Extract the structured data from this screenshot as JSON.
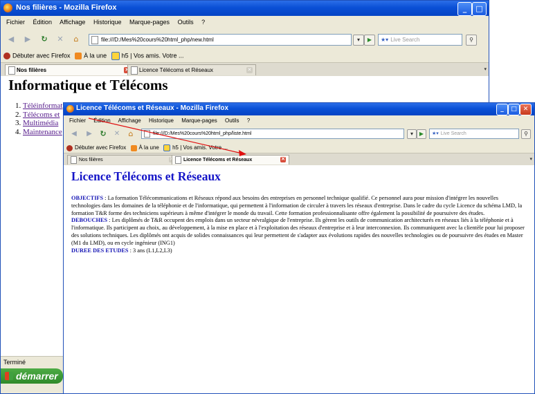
{
  "window1": {
    "title": "Nos filières - Mozilla Firefox",
    "menu": [
      "Fichier",
      "Édition",
      "Affichage",
      "Historique",
      "Marque-pages",
      "Outils",
      "?"
    ],
    "url": "file:///D:/Mes%20cours%20html_php/new.html",
    "search_placeholder": "Live Search",
    "bookmarks": [
      "Débuter avec Firefox",
      "À la une",
      "h5 | Vos amis. Votre ..."
    ],
    "tabs": [
      {
        "label": "Nos filières",
        "active": true
      },
      {
        "label": "Licence Télécoms et Réseaux",
        "active": false
      }
    ],
    "heading": "Informatique et Télécoms",
    "links": [
      "Téléinformat",
      "Télécoms et",
      "Multimédia",
      "Maintenance"
    ],
    "status": "Terminé",
    "start_label": "démarrer"
  },
  "window2": {
    "title": "Licence Télécoms et Réseaux - Mozilla Firefox",
    "menu": [
      "Fichier",
      "Édition",
      "Affichage",
      "Historique",
      "Marque-pages",
      "Outils",
      "?"
    ],
    "url": "file:///D:/Mes%20cours%20html_php/liste.html",
    "search_placeholder": "Live Search",
    "bookmarks": [
      "Débuter avec Firefox",
      "À la une",
      "h5 | Vos amis. Votre ..."
    ],
    "tabs": [
      {
        "label": "Nos filières",
        "active": false
      },
      {
        "label": "Licence Télécoms et Réseaux",
        "active": true
      }
    ],
    "heading": "Licence Télécoms et Réseaux",
    "sections": [
      {
        "label": "OBJECTIFS",
        "text": " : La formation Télécommunications et Réseaux répond aux besoins des entreprises en personnel technique qualifié. Ce personnel aura pour mission d'intégrer les nouvelles technologies dans les domaines de la téléphonie et de l'informatique, qui permettent à l'information de circuler à travers les réseaux d'entreprise. Dans le cadre du cycle Licence du schéma LMD, la formation T&R forme des techniciens supérieurs à même d'intégrer le monde du travail. Cette formation professionnalisante offre également la possibilité de poursuivre des études."
      },
      {
        "label": "DEBOUCHES",
        "text": " : Les diplômés de T&R occupent des emplois dans un secteur névralgique de l'entreprise. Ils gèrent les outils de communication architecturés en réseaux liés à la téléphonie et à l'informatique. Ils participent au choix, au développement, à la mise en place et à l'exploitation des réseaux d'entreprise et à leur interconnexion. Ils communiquent avec la clientèle pour lui proposer des solutions techniques. Les diplômés ont acquis de solides connaissances qui leur permettent de s'adapter aux évolutions rapides des nouvelles technologies ou de poursuivre des études en Master (M1 du LMD), ou en cycle ingénieur (ING1)"
      },
      {
        "label": "DUREE DES ETUDES",
        "text": " : 3 ans (L1,L2,L3)"
      }
    ]
  },
  "colors": {
    "titlebar": "#0a50d6",
    "heading2": "#1515c8",
    "section_label": "#1414b4",
    "link_visited": "#551a8b",
    "arrow": "#e01010"
  }
}
